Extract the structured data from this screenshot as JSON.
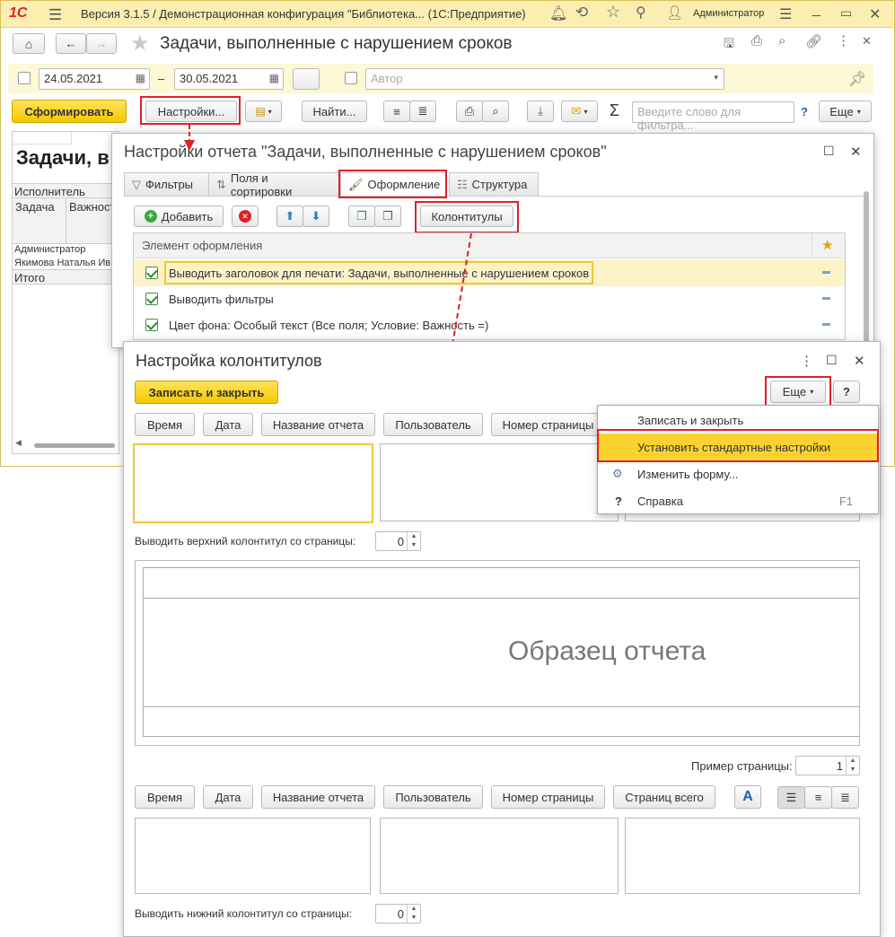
{
  "titlebar": {
    "logo": "1С",
    "title": "Версия 3.1.5 / Демонстрационная конфигурация \"Библиотека... (1С:Предприятие)",
    "user": "Администратор"
  },
  "main": {
    "page_title": "Задачи, выполненные с нарушением сроков",
    "date_from": "24.05.2021",
    "dash": "–",
    "date_to": "30.05.2021",
    "author_placeholder": "Автор",
    "generate_label": "Сформировать",
    "settings_label": "Настройки...",
    "find_label": "Найти...",
    "search_placeholder": "Введите слово для фильтра...",
    "help_label": "?",
    "more_label": "Еще",
    "report": {
      "title": "Задачи, в",
      "col_executor": "Исполнитель",
      "col_task": "Задача",
      "col_importance": "Важност",
      "row1": "Администратор",
      "row2": "Якимова Наталья Ив",
      "total": "Итого"
    }
  },
  "settings_dialog": {
    "title": "Настройки отчета \"Задачи, выполненные с нарушением сроков\"",
    "tabs": [
      "Фильтры",
      "Поля и сортировки",
      "Оформление",
      "Структура"
    ],
    "add_label": "Добавить",
    "headers_footers_label": "Колонтитулы",
    "col_header": "Элемент оформления",
    "rows": [
      "Выводить заголовок для печати: Задачи, выполненные с нарушением сроков",
      "Выводить фильтры",
      "Цвет фона: Особый текст (Все поля; Условие: Важность =)"
    ]
  },
  "hf_dialog": {
    "title": "Настройка колонтитулов",
    "save_close_label": "Записать и закрыть",
    "more_label": "Еще",
    "help_label": "?",
    "top_buttons": [
      "Время",
      "Дата",
      "Название отчета",
      "Пользователь",
      "Номер страницы"
    ],
    "bottom_buttons": [
      "Время",
      "Дата",
      "Название отчета",
      "Пользователь",
      "Номер страницы",
      "Страниц всего"
    ],
    "font_button": "A",
    "top_from_label": "Выводить верхний колонтитул со страницы:",
    "top_from_value": "0",
    "sample_text": "Образец отчета",
    "sample_page_label": "Пример страницы:",
    "sample_page_value": "1",
    "bottom_from_label": "Выводить нижний колонтитул со страницы:",
    "bottom_from_value": "0"
  },
  "more_menu": {
    "items": [
      {
        "label": "Записать и закрыть",
        "shortcut": ""
      },
      {
        "label": "Установить стандартные настройки",
        "shortcut": ""
      },
      {
        "label": "Изменить форму...",
        "shortcut": ""
      },
      {
        "label": "Справка",
        "shortcut": "F1"
      }
    ]
  },
  "colors": {
    "accent_red": "#e0202a",
    "highlight_yellow": "#fcd230",
    "toolbar_yellow": "#fdf8d6"
  }
}
